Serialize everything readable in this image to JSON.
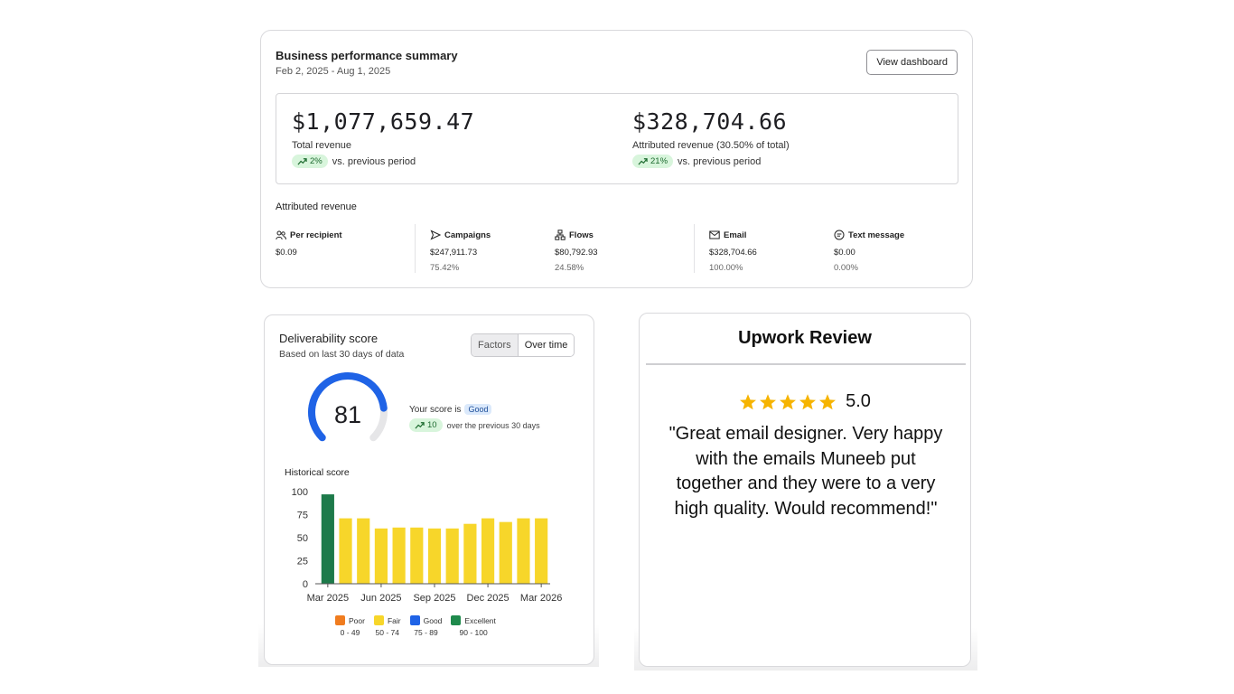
{
  "performance": {
    "title": "Business performance summary",
    "date_range": "Feb 2, 2025 - Aug 1, 2025",
    "view_dashboard_label": "View dashboard",
    "total": {
      "value": "$1,077,659.47",
      "label": "Total revenue",
      "change": "2%",
      "change_text": "vs. previous period"
    },
    "attributed": {
      "value": "$328,704.66",
      "label": "Attributed revenue (30.50% of total)",
      "change": "21%",
      "change_text": "vs. previous period"
    },
    "attributed_title": "Attributed revenue",
    "items": [
      {
        "icon": "people-icon",
        "label": "Per recipient",
        "value": "$0.09",
        "pct": ""
      },
      {
        "icon": "send-icon",
        "label": "Campaigns",
        "value": "$247,911.73",
        "pct": "75.42%"
      },
      {
        "icon": "flow-icon",
        "label": "Flows",
        "value": "$80,792.93",
        "pct": "24.58%"
      },
      {
        "icon": "mail-icon",
        "label": "Email",
        "value": "$328,704.66",
        "pct": "100.00%"
      },
      {
        "icon": "message-icon",
        "label": "Text message",
        "value": "$0.00",
        "pct": "0.00%"
      }
    ],
    "positive_color": "#1d6b2f"
  },
  "deliverability": {
    "title": "Deliverability score",
    "subtitle": "Based on last 30 days of data",
    "tabs": [
      "Factors",
      "Over time"
    ],
    "active_tab": "Factors",
    "score": "81",
    "score_fraction": 0.81,
    "score_text": "Your score is",
    "badge": "Good",
    "change": "10",
    "change_text": "over the previous 30 days",
    "historical_title": "Historical score",
    "gauge_color": "#1f63e6",
    "legend": [
      {
        "label": "Poor",
        "range": "0 - 49",
        "color": "#f07c1f"
      },
      {
        "label": "Fair",
        "range": "50 - 74",
        "color": "#f7d62a"
      },
      {
        "label": "Good",
        "range": "75 - 89",
        "color": "#1f63e6"
      },
      {
        "label": "Excellent",
        "range": "90 - 100",
        "color": "#1f8a4c"
      }
    ]
  },
  "chart_data": {
    "type": "bar",
    "title": "Historical score",
    "yticks": [
      0,
      25,
      50,
      75,
      100
    ],
    "ylim": [
      0,
      100
    ],
    "xtick_labels": [
      "Mar 2025",
      "Jun 2025",
      "Sep 2025",
      "Dec 2025",
      "Mar 2026"
    ],
    "values": [
      97,
      71,
      71,
      60,
      61,
      61,
      60,
      60,
      65,
      71,
      67,
      71,
      71
    ],
    "colors": [
      "#1d7a4a",
      "#f7d62a",
      "#f7d62a",
      "#f7d62a",
      "#f7d62a",
      "#f7d62a",
      "#f7d62a",
      "#f7d62a",
      "#f7d62a",
      "#f7d62a",
      "#f7d62a",
      "#f7d62a",
      "#f7d62a"
    ],
    "grid": false
  },
  "review": {
    "title": "Upwork Review",
    "stars": 5,
    "rating": "5.0",
    "star_color": "#f6b400",
    "text": "\"Great email designer. Very happy with the emails Muneeb put together and they were to a very high quality. Would recommend!\""
  }
}
